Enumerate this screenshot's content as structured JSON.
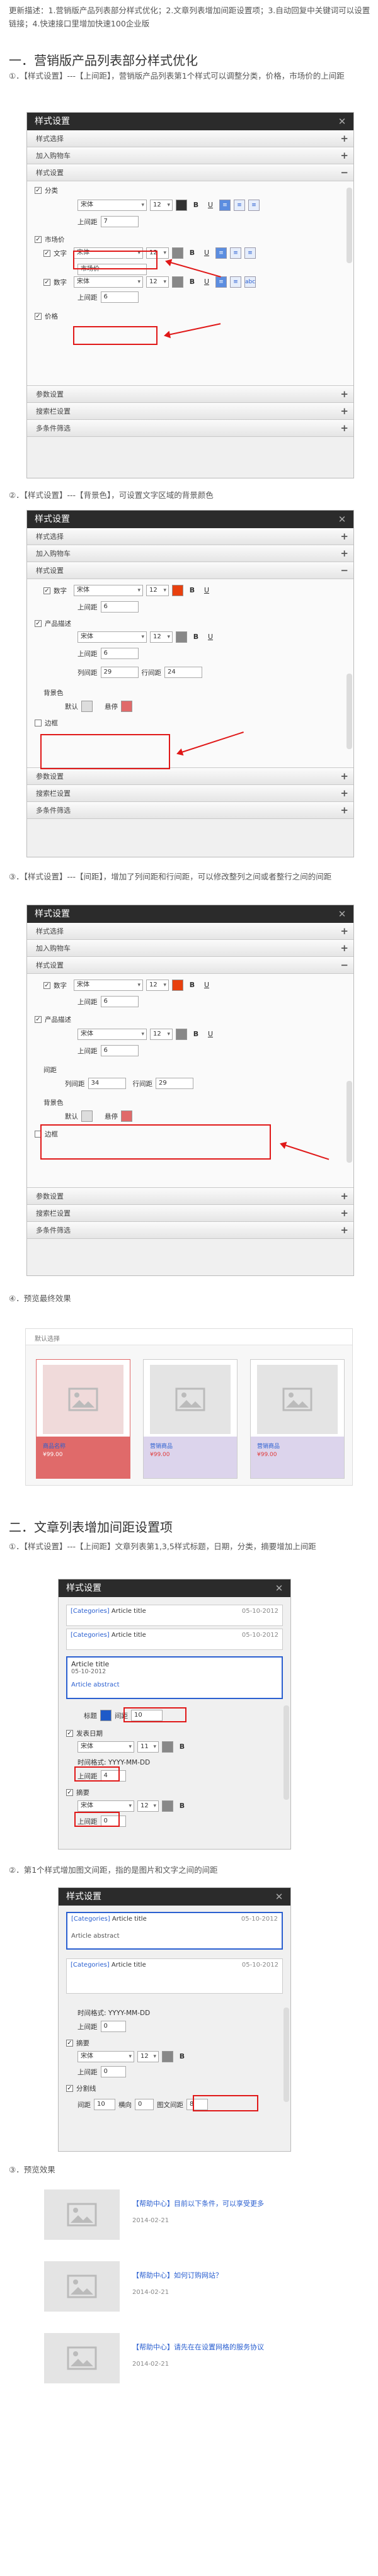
{
  "intro": "更新描述：1.营销版产品列表部分样式优化；2.文章列表增加间距设置项；3.自动回复中关键词可以设置链接；4.快速接口里增加快速100企业版",
  "section1": {
    "heading": "一．营销版产品列表部分样式优化",
    "p1": "①．【样式设置】---【上间距】，营销版产品列表第1个样式可以调整分类，价格，市场价的上间距",
    "p2": "②．【样式设置】---【背景色】，可设置文字区域的背景颜色",
    "p3": "③．【样式设置】---【间距】，增加了列间距和行间距，可以修改整列之间或者整行之间的间距",
    "p4": "④．预览最终效果"
  },
  "section2": {
    "heading": "二．文章列表增加间距设置项",
    "p1": "①．【样式设置】---【上间距】文章列表第1,3,5样式标题，日期，分类，摘要增加上间距",
    "p2": "②．第1个样式增加图文间距，指的是图片和文字之间的间距",
    "p3": "③．预览效果"
  },
  "panel": {
    "title": "样式设置",
    "acc_select": "样式选择",
    "acc_cart": "加入购物车",
    "acc_style": "样式设置",
    "acc_params": "参数设置",
    "acc_search": "搜索栏设置",
    "acc_filter": "多条件筛选"
  },
  "p1": {
    "category": "分类",
    "font": "宋体",
    "size": "12",
    "bold": "B",
    "underline": "U",
    "top_label": "上间距",
    "top_val": "7",
    "price": "价格",
    "market": "市场价",
    "text": "文字",
    "number": "数字",
    "word": "市场价",
    "top_val2": "6",
    "cat_label": "价格"
  },
  "p2": {
    "number": "数字",
    "desc": "产品描述",
    "top_label": "上间距",
    "v1": "6",
    "v2": "6",
    "col": "列间距",
    "colv": "29",
    "rowl": "行间距",
    "rowv": "24",
    "bg": "背景色",
    "def": "默认",
    "hover": "悬停",
    "border": "边框"
  },
  "p3": {
    "number": "数字",
    "desc": "产品描述",
    "gap": "间距",
    "col": "列间距",
    "colv": "34",
    "rowl": "行间距",
    "rowv": "29",
    "bg": "背景色",
    "def": "默认",
    "hover": "悬停",
    "border": "边框",
    "v1": "6",
    "v2": "6"
  },
  "preview": {
    "tab": "默认选择",
    "name1": "商品名称",
    "name2": "营销商品",
    "name3": "营销商品",
    "price1": "¥99.00",
    "price2": "¥99.00",
    "price3": "¥99.00"
  },
  "p4": {
    "cat": "[Categories]",
    "art": "Article title",
    "date": "05-10-2012",
    "title": "Article title",
    "date2": "05-10-2012",
    "abstract": "Article abstract",
    "title_label": "标题",
    "gap": "间距",
    "gapv": "10",
    "cat_label": "发表日期",
    "date_fmt": "时间格式: YYYY-MM-DD",
    "top": "上间距",
    "topv": "4",
    "abs": "摘要",
    "topv2": "0",
    "font": "宋体",
    "size": "11",
    "size2": "12"
  },
  "p5": {
    "cat": "[Categories]",
    "art": "Article title",
    "date": "05-10-2012",
    "abstract": "Article abstract",
    "date_fmt": "时间格式: YYYY-MM-DD",
    "abs": "摘要",
    "cls": "分割线",
    "gap": "间距",
    "g1": "10",
    "g2": "横向",
    "g3": "0",
    "imgtext": "图文间距",
    "imgv": "8",
    "top": "上间距",
    "topv": "0",
    "font": "宋体",
    "size": "12"
  },
  "preview2": {
    "i1": "【帮助中心】目前以下条件，可以享受更多",
    "d1": "2014-02-21",
    "i2": "【帮助中心】如何订购网站？",
    "d2": "2014-02-21",
    "i3": "【帮助中心】请先在在设置网格的服务协议",
    "d3": "2014-02-21"
  }
}
